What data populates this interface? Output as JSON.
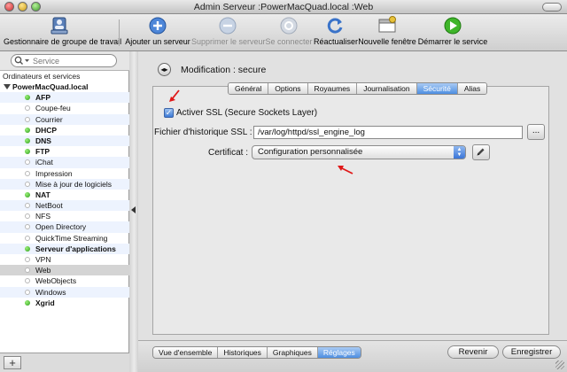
{
  "window": {
    "title": "Admin Serveur :PowerMacQuad.local :Web"
  },
  "toolbar": {
    "manager_label": "Gestionnaire de groupe de travail",
    "add_server": "Ajouter un serveur",
    "remove_server": "Supprimer le serveur",
    "connect": "Se connecter",
    "refresh": "Réactualiser",
    "new_window": "Nouvelle fenêtre",
    "start_service": "Démarrer le service"
  },
  "sidebar": {
    "search_placeholder": "Service",
    "header": "Ordinateurs et services",
    "server": "PowerMacQuad.local",
    "items": [
      {
        "label": "AFP",
        "running": true
      },
      {
        "label": "Coupe-feu",
        "running": false
      },
      {
        "label": "Courrier",
        "running": false
      },
      {
        "label": "DHCP",
        "running": true
      },
      {
        "label": "DNS",
        "running": true
      },
      {
        "label": "FTP",
        "running": true
      },
      {
        "label": "iChat",
        "running": false
      },
      {
        "label": "Impression",
        "running": false
      },
      {
        "label": "Mise à jour de logiciels",
        "running": false
      },
      {
        "label": "NAT",
        "running": true
      },
      {
        "label": "NetBoot",
        "running": false
      },
      {
        "label": "NFS",
        "running": false
      },
      {
        "label": "Open Directory",
        "running": false
      },
      {
        "label": "QuickTime Streaming",
        "running": false
      },
      {
        "label": "Serveur d'applications",
        "running": true
      },
      {
        "label": "VPN",
        "running": false
      },
      {
        "label": "Web",
        "running": false,
        "selected": true
      },
      {
        "label": "WebObjects",
        "running": false
      },
      {
        "label": "Windows",
        "running": false
      },
      {
        "label": "Xgrid",
        "running": true
      }
    ]
  },
  "main": {
    "heading": "Modification :  secure",
    "tabs": [
      {
        "label": "Général",
        "active": false
      },
      {
        "label": "Options",
        "active": false
      },
      {
        "label": "Royaumes",
        "active": false
      },
      {
        "label": "Journalisation",
        "active": false
      },
      {
        "label": "Sécurité",
        "active": true
      },
      {
        "label": "Alias",
        "active": false
      }
    ],
    "ssl_checkbox_label": "Activer SSL (Secure Sockets Layer)",
    "ssl_checked": true,
    "log_label": "Fichier d'historique SSL :",
    "log_value": "/var/log/httpd/ssl_engine_log",
    "browse_label": "...",
    "certificate_label": "Certificat :",
    "certificate_value": "Configuration personnalisée"
  },
  "bottom": {
    "views": [
      {
        "label": "Vue d'ensemble",
        "active": false
      },
      {
        "label": "Historiques",
        "active": false
      },
      {
        "label": "Graphiques",
        "active": false
      },
      {
        "label": "Réglages",
        "active": true
      }
    ],
    "revert": "Revenir",
    "save": "Enregistrer"
  },
  "colors": {
    "accent": "#4d8ee1",
    "running": "#2a9a18",
    "annotation": "#e01818"
  }
}
